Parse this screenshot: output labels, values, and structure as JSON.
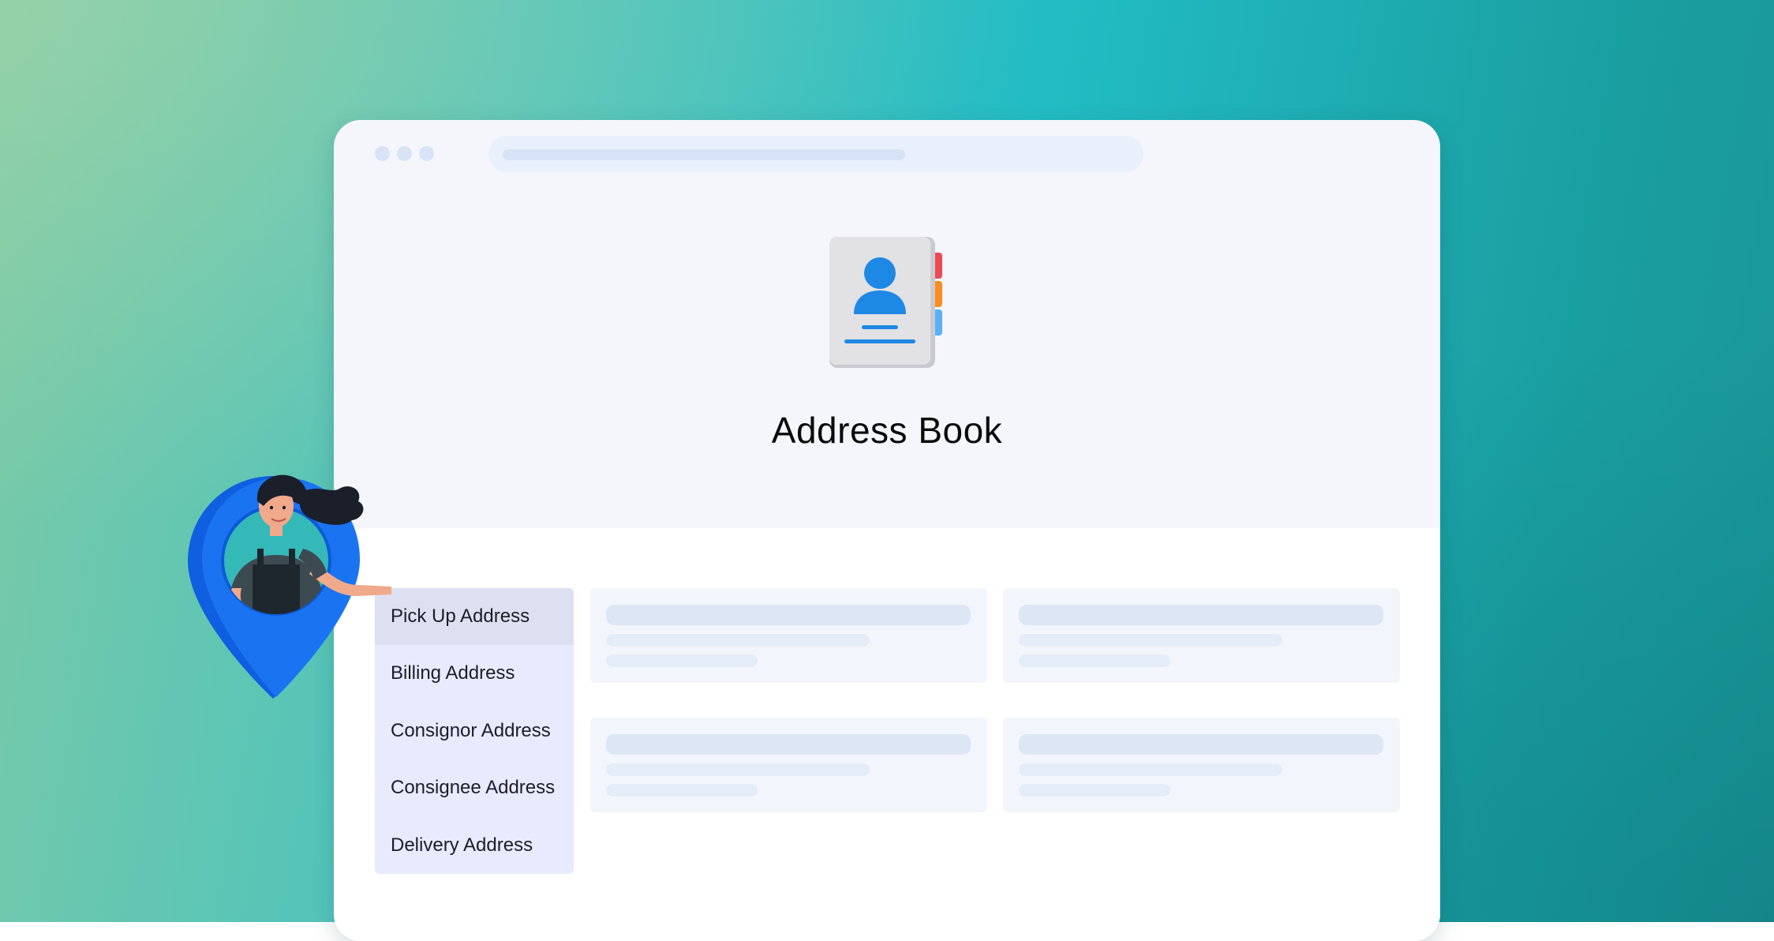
{
  "page": {
    "title": "Address Book"
  },
  "address_tabs": {
    "active_index": 0,
    "items": [
      {
        "label": "Pick Up Address"
      },
      {
        "label": "Billing Address"
      },
      {
        "label": "Consignor Address"
      },
      {
        "label": "Consignee Address"
      },
      {
        "label": "Delivery Address"
      }
    ]
  },
  "icons": {
    "header": "address-book-icon",
    "illustration": "location-pin-icon"
  },
  "colors": {
    "accent_blue": "#1e88e5",
    "tab_red": "#ee4a55",
    "tab_orange": "#fb8c1e",
    "tab_light_blue": "#5ab0f5",
    "pin_blue": "#1a74f2",
    "tabs_background": "#e8ebfd",
    "active_tab": "#dde0f0"
  }
}
